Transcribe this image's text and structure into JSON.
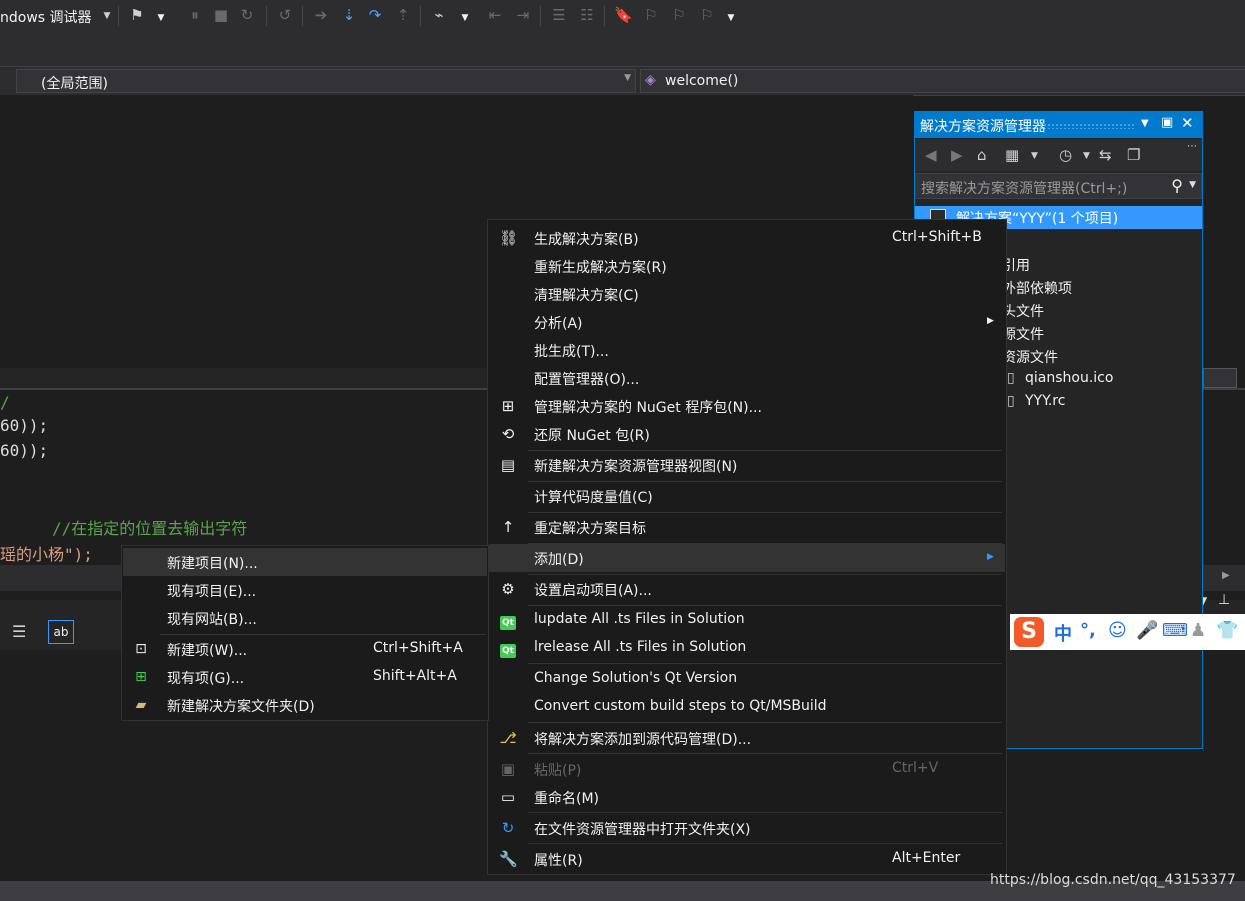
{
  "toolbar": {
    "debugger_label": "ndows 调试器"
  },
  "navbar": {
    "scope": "(全局范围)",
    "member": "welcome()"
  },
  "editor": {
    "lines": [
      "/",
      "60));",
      "60));"
    ],
    "comment": "//在指定的位置去输出字符",
    "string_line": "瑶的小杨\");"
  },
  "solution_explorer": {
    "title": "解决方案资源管理器",
    "search_placeholder": "搜索解决方案资源管理器(Ctrl+;)",
    "selected": "解决方案“YYY”(1 个项目)",
    "items": [
      "引用",
      "外部依赖项",
      "头文件",
      "源文件",
      "资源文件",
      "qianshou.ico",
      "YYY.rc"
    ]
  },
  "context_menu": {
    "items": [
      {
        "label": "生成解决方案(B)",
        "shortcut": "Ctrl+Shift+B",
        "icon": "build-icon"
      },
      {
        "label": "重新生成解决方案(R)",
        "shortcut": ""
      },
      {
        "label": "清理解决方案(C)",
        "shortcut": ""
      },
      {
        "label": "分析(A)",
        "shortcut": "",
        "submenu": true
      },
      {
        "label": "批生成(T)...",
        "shortcut": ""
      },
      {
        "label": "配置管理器(O)...",
        "shortcut": ""
      },
      {
        "label": "管理解决方案的 NuGet 程序包(N)...",
        "shortcut": "",
        "icon": "nuget-package-icon"
      },
      {
        "label": "还原 NuGet 包(R)",
        "shortcut": "",
        "icon": "restore-icon"
      },
      {
        "label": "新建解决方案资源管理器视图(N)",
        "shortcut": "",
        "icon": "new-view-icon"
      },
      {
        "label": "计算代码度量值(C)",
        "shortcut": ""
      },
      {
        "label": "重定解决方案目标",
        "shortcut": "",
        "icon": "retarget-icon"
      },
      {
        "label": "添加(D)",
        "shortcut": "",
        "submenu": true
      },
      {
        "label": "设置启动项目(A)...",
        "shortcut": "",
        "icon": "gear-icon"
      },
      {
        "label": "lupdate All .ts Files in Solution",
        "shortcut": "",
        "icon": "qt-icon"
      },
      {
        "label": "lrelease All .ts Files in Solution",
        "shortcut": "",
        "icon": "qt-icon"
      },
      {
        "label": "Change Solution's Qt Version",
        "shortcut": ""
      },
      {
        "label": "Convert custom build steps to Qt/MSBuild",
        "shortcut": ""
      },
      {
        "label": "将解决方案添加到源代码管理(D)...",
        "shortcut": "",
        "icon": "source-control-icon"
      },
      {
        "label": "粘贴(P)",
        "shortcut": "Ctrl+V",
        "icon": "paste-icon",
        "disabled": true
      },
      {
        "label": "重命名(M)",
        "shortcut": "",
        "icon": "rename-icon"
      },
      {
        "label": "在文件资源管理器中打开文件夹(X)",
        "shortcut": "",
        "icon": "open-folder-icon"
      },
      {
        "label": "属性(R)",
        "shortcut": "Alt+Enter",
        "icon": "wrench-icon"
      }
    ]
  },
  "submenu": {
    "items": [
      {
        "label": "新建项目(N)...",
        "shortcut": ""
      },
      {
        "label": "现有项目(E)...",
        "shortcut": ""
      },
      {
        "label": "现有网站(B)...",
        "shortcut": ""
      },
      {
        "label": "新建项(W)...",
        "shortcut": "Ctrl+Shift+A",
        "icon": "new-item-icon"
      },
      {
        "label": "现有项(G)...",
        "shortcut": "Shift+Alt+A",
        "icon": "existing-item-icon"
      },
      {
        "label": "新建解决方案文件夹(D)",
        "shortcut": "",
        "icon": "new-folder-icon"
      }
    ]
  },
  "ime": {
    "logo": "S",
    "mode": "中"
  },
  "watermark": "https://blog.csdn.net/qq_43153377",
  "colors": {
    "accent": "#007acc",
    "selection": "#3399ff",
    "menu_bg": "#1b1b1c",
    "comment": "#57a64a",
    "string": "#d69d85"
  }
}
